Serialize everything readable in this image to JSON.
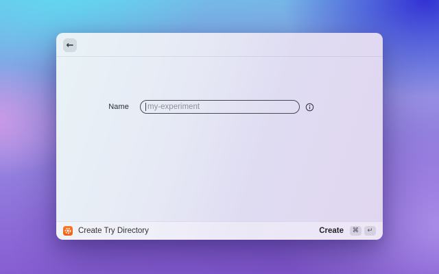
{
  "window": {
    "back_button": {
      "icon": "←"
    },
    "form": {
      "name": {
        "label": "Name",
        "placeholder": "my-experiment"
      }
    },
    "footer": {
      "extension": {
        "name": "Create Try Directory",
        "icon": "gear-icon",
        "icon_color": "#F4691E"
      },
      "action": {
        "label": "Create",
        "keys": [
          "⌘",
          "↵"
        ]
      }
    }
  },
  "colors": {
    "accent_orange": "#F4691E",
    "input_border": "#46464E",
    "placeholder_text": "#8F8F99",
    "background_top_left": "#60DAF2",
    "background_top_right": "#3331D4",
    "background_mid_left": "#D09AE6",
    "background_bottom": "#8153CD"
  }
}
